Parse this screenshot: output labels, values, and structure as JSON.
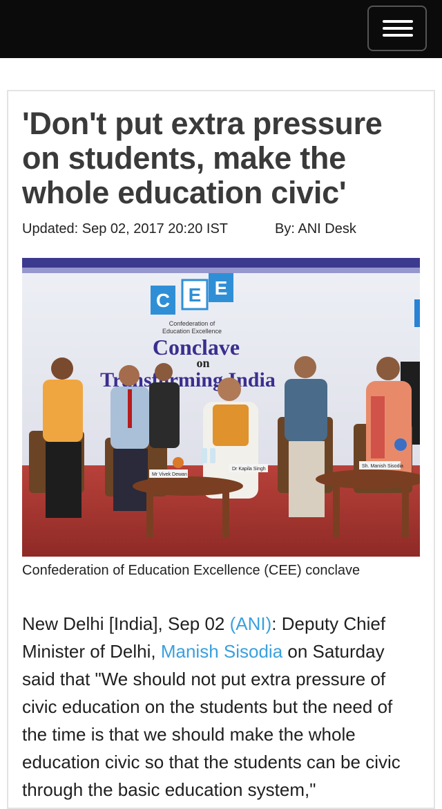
{
  "header": {
    "menu_icon": "hamburger-icon"
  },
  "article": {
    "title": "'Don't put extra pressure on students, make the whole education civic'",
    "updated": "Updated: Sep 02, 2017 20:20 IST",
    "byline": "By: ANI Desk",
    "image": {
      "banner_logo": "CEE",
      "banner_org": "Confederation of Education Excellence",
      "banner_title": "Conclave",
      "banner_on": "on",
      "banner_subtitle": "Transforming India",
      "nameplates": [
        "Mr Vivek Dewan",
        "Dr Kapila Singh",
        "Sh. Manish Sisodia"
      ]
    },
    "caption": "Confederation of Education Excellence (CEE) conclave",
    "body": {
      "p1": "New Delhi [India], Sep 02 ",
      "link1": "(ANI)",
      "p2": ": Deputy Chief Minister of Delhi, ",
      "link2": "Manish Sisodia",
      "p3": " on Saturday said that \"We should not put extra pressure of civic education on the students but the need of the time is that we should make the whole education civic so that the students can be civic through the basic education system,\""
    }
  }
}
